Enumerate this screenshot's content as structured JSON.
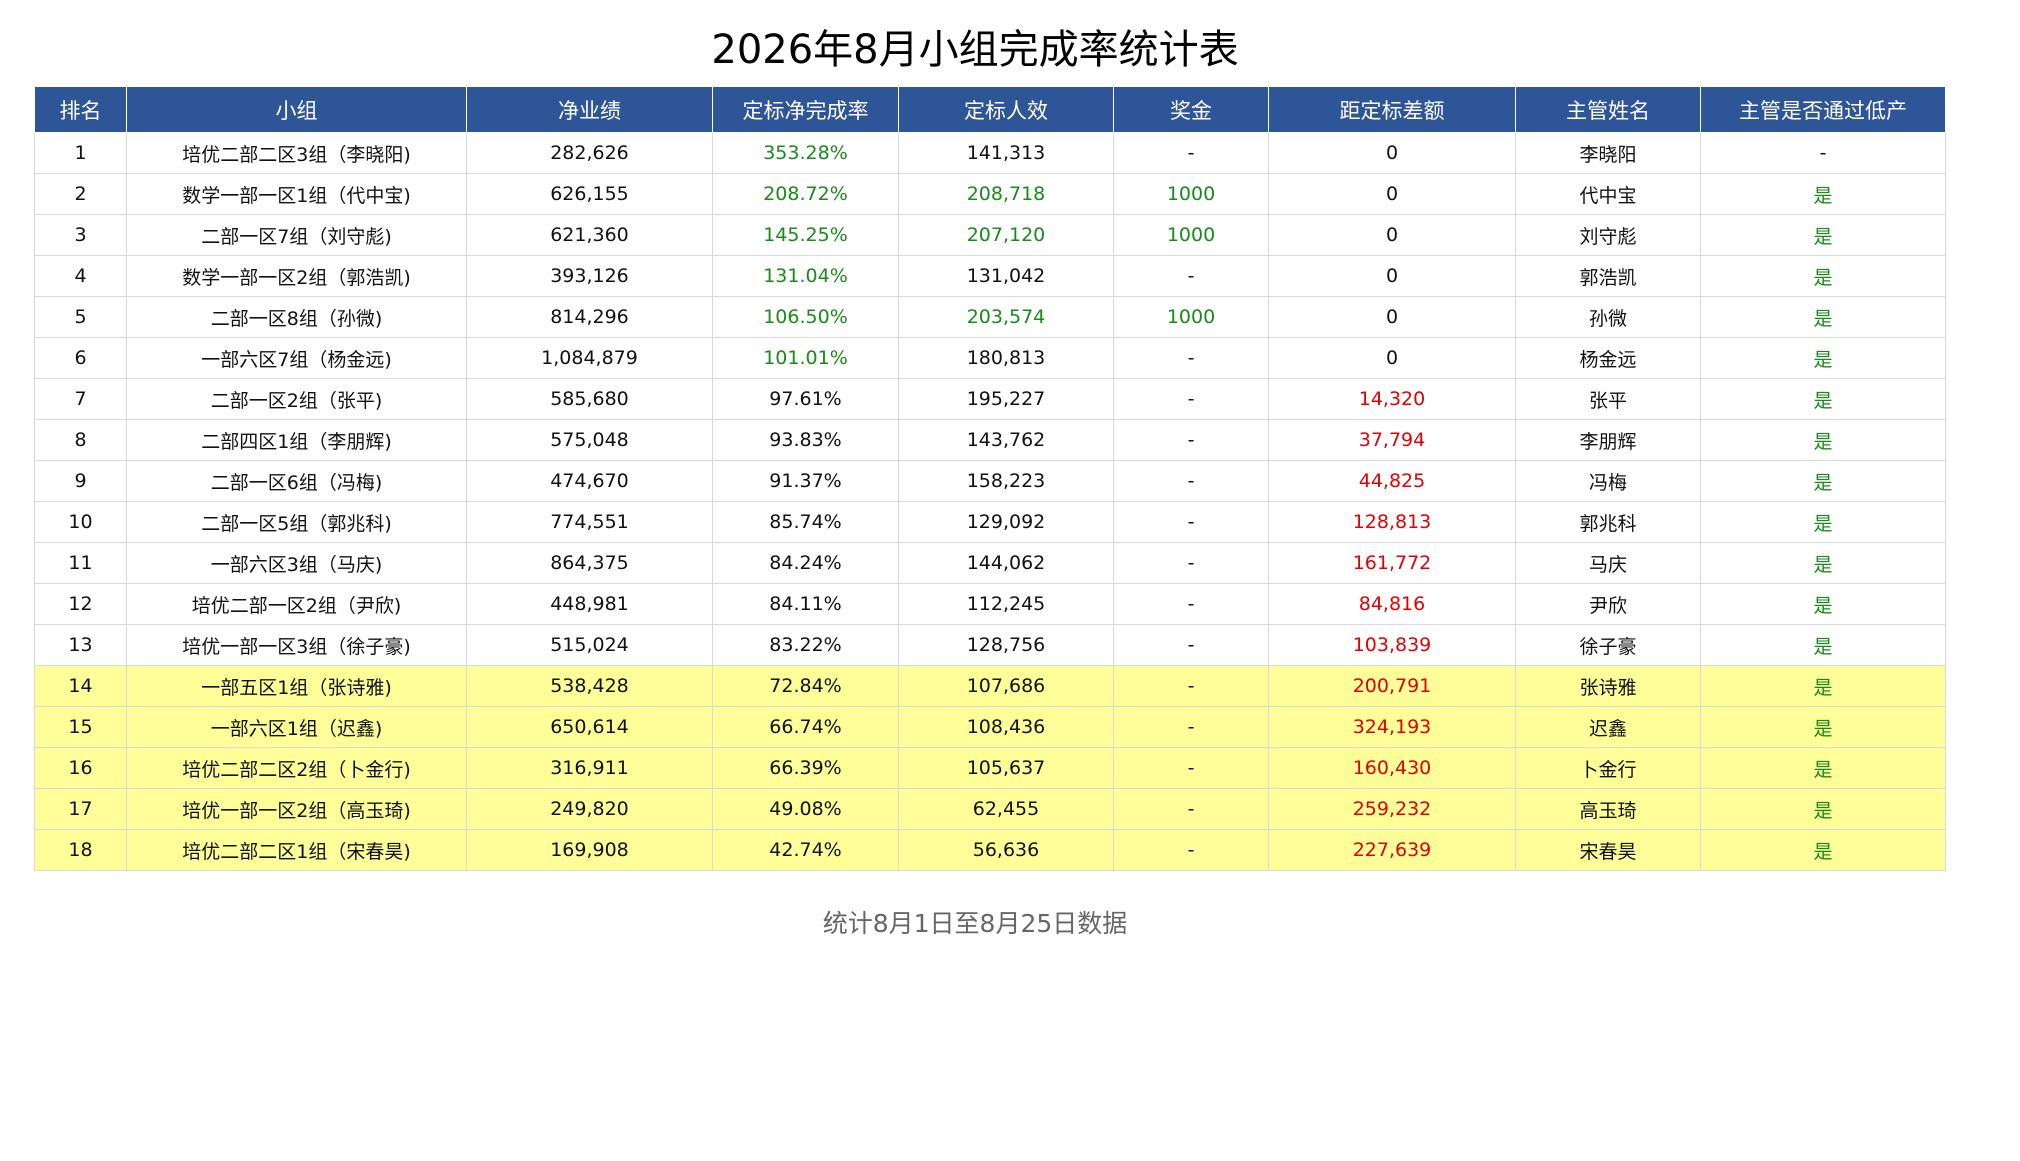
{
  "title": "2026年8月小组完成率统计表",
  "colors": {
    "header_bg": "#2e5597",
    "highlight_bg": "#ffff99",
    "positive": "#1a8a1a",
    "negative": "#e30000"
  },
  "table": {
    "headers": [
      "排名",
      "小组",
      "净业绩",
      "定标净完成率",
      "定标人效",
      "奖金",
      "距定标差额",
      "主管姓名",
      "主管是否通过低产"
    ],
    "rows": [
      {
        "rank": "1",
        "group": "培优二部二区3组（李晓阳)",
        "net": "282,626",
        "rate": "353.28%",
        "eff": "141,313",
        "bonus": "-",
        "gap": "0",
        "leader": "李晓阳",
        "passed": "-",
        "highlight": false,
        "eff_green": false
      },
      {
        "rank": "2",
        "group": "数学一部一区1组（代中宝)",
        "net": "626,155",
        "rate": "208.72%",
        "eff": "208,718",
        "bonus": "1000",
        "gap": "0",
        "leader": "代中宝",
        "passed": "是",
        "highlight": false,
        "eff_green": true
      },
      {
        "rank": "3",
        "group": "二部一区7组（刘守彪)",
        "net": "621,360",
        "rate": "145.25%",
        "eff": "207,120",
        "bonus": "1000",
        "gap": "0",
        "leader": "刘守彪",
        "passed": "是",
        "highlight": false,
        "eff_green": true
      },
      {
        "rank": "4",
        "group": "数学一部一区2组（郭浩凯)",
        "net": "393,126",
        "rate": "131.04%",
        "eff": "131,042",
        "bonus": "-",
        "gap": "0",
        "leader": "郭浩凯",
        "passed": "是",
        "highlight": false,
        "eff_green": false
      },
      {
        "rank": "5",
        "group": "二部一区8组（孙微)",
        "net": "814,296",
        "rate": "106.50%",
        "eff": "203,574",
        "bonus": "1000",
        "gap": "0",
        "leader": "孙微",
        "passed": "是",
        "highlight": false,
        "eff_green": true
      },
      {
        "rank": "6",
        "group": "一部六区7组（杨金远)",
        "net": "1,084,879",
        "rate": "101.01%",
        "eff": "180,813",
        "bonus": "-",
        "gap": "0",
        "leader": "杨金远",
        "passed": "是",
        "highlight": false,
        "eff_green": false
      },
      {
        "rank": "7",
        "group": "二部一区2组（张平)",
        "net": "585,680",
        "rate": "97.61%",
        "eff": "195,227",
        "bonus": "-",
        "gap": "14,320",
        "leader": "张平",
        "passed": "是",
        "highlight": false,
        "eff_green": false
      },
      {
        "rank": "8",
        "group": "二部四区1组（李朋辉)",
        "net": "575,048",
        "rate": "93.83%",
        "eff": "143,762",
        "bonus": "-",
        "gap": "37,794",
        "leader": "李朋辉",
        "passed": "是",
        "highlight": false,
        "eff_green": false
      },
      {
        "rank": "9",
        "group": "二部一区6组（冯梅)",
        "net": "474,670",
        "rate": "91.37%",
        "eff": "158,223",
        "bonus": "-",
        "gap": "44,825",
        "leader": "冯梅",
        "passed": "是",
        "highlight": false,
        "eff_green": false
      },
      {
        "rank": "10",
        "group": "二部一区5组（郭兆科)",
        "net": "774,551",
        "rate": "85.74%",
        "eff": "129,092",
        "bonus": "-",
        "gap": "128,813",
        "leader": "郭兆科",
        "passed": "是",
        "highlight": false,
        "eff_green": false
      },
      {
        "rank": "11",
        "group": "一部六区3组（马庆)",
        "net": "864,375",
        "rate": "84.24%",
        "eff": "144,062",
        "bonus": "-",
        "gap": "161,772",
        "leader": "马庆",
        "passed": "是",
        "highlight": false,
        "eff_green": false
      },
      {
        "rank": "12",
        "group": "培优二部一区2组（尹欣)",
        "net": "448,981",
        "rate": "84.11%",
        "eff": "112,245",
        "bonus": "-",
        "gap": "84,816",
        "leader": "尹欣",
        "passed": "是",
        "highlight": false,
        "eff_green": false
      },
      {
        "rank": "13",
        "group": "培优一部一区3组（徐子豪)",
        "net": "515,024",
        "rate": "83.22%",
        "eff": "128,756",
        "bonus": "-",
        "gap": "103,839",
        "leader": "徐子豪",
        "passed": "是",
        "highlight": false,
        "eff_green": false
      },
      {
        "rank": "14",
        "group": "一部五区1组（张诗雅)",
        "net": "538,428",
        "rate": "72.84%",
        "eff": "107,686",
        "bonus": "-",
        "gap": "200,791",
        "leader": "张诗雅",
        "passed": "是",
        "highlight": true,
        "eff_green": false
      },
      {
        "rank": "15",
        "group": "一部六区1组（迟鑫)",
        "net": "650,614",
        "rate": "66.74%",
        "eff": "108,436",
        "bonus": "-",
        "gap": "324,193",
        "leader": "迟鑫",
        "passed": "是",
        "highlight": true,
        "eff_green": false
      },
      {
        "rank": "16",
        "group": "培优二部二区2组（卜金行)",
        "net": "316,911",
        "rate": "66.39%",
        "eff": "105,637",
        "bonus": "-",
        "gap": "160,430",
        "leader": "卜金行",
        "passed": "是",
        "highlight": true,
        "eff_green": false
      },
      {
        "rank": "17",
        "group": "培优一部一区2组（高玉琦)",
        "net": "249,820",
        "rate": "49.08%",
        "eff": "62,455",
        "bonus": "-",
        "gap": "259,232",
        "leader": "高玉琦",
        "passed": "是",
        "highlight": true,
        "eff_green": false
      },
      {
        "rank": "18",
        "group": "培优二部二区1组（宋春昊)",
        "net": "169,908",
        "rate": "42.74%",
        "eff": "56,636",
        "bonus": "-",
        "gap": "227,639",
        "leader": "宋春昊",
        "passed": "是",
        "highlight": true,
        "eff_green": false
      }
    ]
  },
  "footnote": "统计8月1日至8月25日数据"
}
